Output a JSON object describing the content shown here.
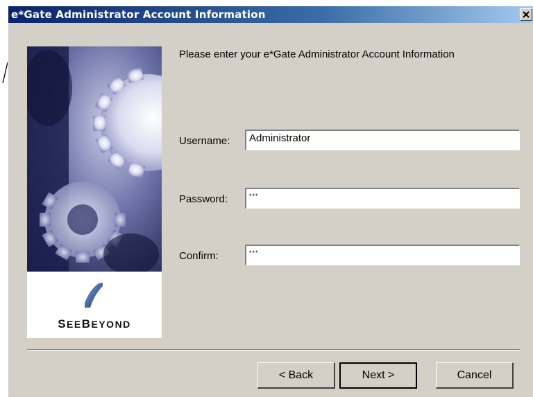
{
  "window": {
    "title": "e*Gate Administrator Account Information",
    "close_icon": "close-icon"
  },
  "side_panel": {
    "artwork": "gears-artwork",
    "logo_initial_1": "S",
    "logo_rest_1": "EE",
    "logo_initial_2": "B",
    "logo_rest_2": "EYOND",
    "logo_icon": "seebeyond-logo-icon"
  },
  "form": {
    "prompt": "Please enter your e*Gate Administrator Account Information",
    "username_label": "Username:",
    "username_value": "Administrator",
    "password_label": "Password:",
    "password_value": "***",
    "confirm_label": "Confirm:",
    "confirm_value": "***"
  },
  "buttons": {
    "back": "< Back",
    "next": "Next >",
    "cancel": "Cancel"
  },
  "colors": {
    "title_bar_start": "#0a246a",
    "title_bar_end": "#a6caf0",
    "dialog_face": "#d4d0c8"
  }
}
